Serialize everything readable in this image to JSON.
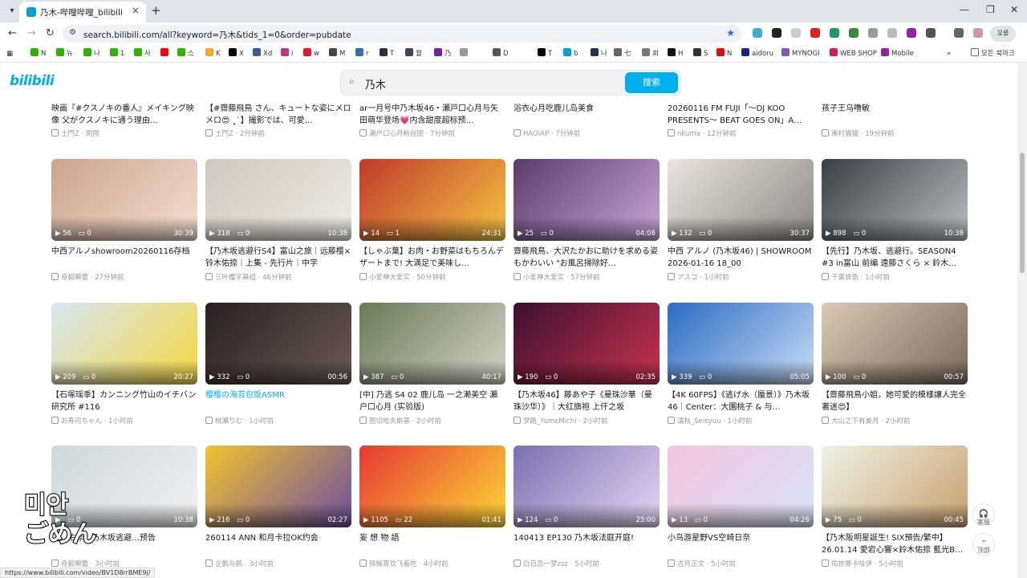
{
  "browser": {
    "tab_title": "乃木-哔哩哔哩_bilibili",
    "url": "search.bilibili.com/all?keyword=乃木&tids_1=0&order=pubdate",
    "profile_label": "오류",
    "bookmarks": [
      "N",
      "뉴",
      "나",
      "1",
      "사",
      "",
      "스",
      "K",
      "X",
      "Xd",
      "i",
      "w",
      "M",
      "r",
      "T",
      "월",
      "乃",
      "",
      "D",
      "T",
      "b",
      "나",
      "七",
      "회",
      "H",
      "S",
      "N",
      "aidoru",
      "MYNOGI",
      "WEB SHOP",
      "Mobile"
    ],
    "bookmark_folder": "모든 북마크",
    "status_url": "https://www.bilibili.com/video/BV1D8rrBME9j/"
  },
  "header": {
    "logo": "bilibili",
    "search_value": "乃木",
    "search_button": "搜索"
  },
  "top_row": [
    {
      "title": "映画『#クスノキの番人』メイキング映像 父がクスノキに通う理由…",
      "uploader": "土門Z",
      "time": "刚刚"
    },
    {
      "title": "【#齋藤飛鳥 さん、キュートな姿にメロメロ😍 ˎ̥ˋ】撮影では、可愛…",
      "uploader": "土門Z",
      "time": "2分钟前"
    },
    {
      "title": "ar一月号中乃木坂46・瀬戸口心月与矢田萌华登场💗内含甜度超标预…",
      "uploader": "濑户口心月粉丝团",
      "time": "7分钟前"
    },
    {
      "title": "浴衣心月吃鹿儿岛美食",
      "uploader": "HAOIAP",
      "time": "7分钟前"
    },
    {
      "title": "20260116 FM FUJI「～DJ KOO PRESENTS～ BEAT GOES ON」A…",
      "uploader": "nkuma",
      "time": "12分钟前"
    },
    {
      "title": "孩子王乌噜敏",
      "uploader": "東村猫猫",
      "time": "19分钟前"
    }
  ],
  "rows": [
    [
      {
        "views": "56",
        "danmaku": "0",
        "duration": "30:39",
        "title": "中西アルノshowroom20260116存档",
        "uploader": "奇毅瞬蕾",
        "time": "27分钟前",
        "hl": false
      },
      {
        "views": "318",
        "danmaku": "0",
        "duration": "10:38",
        "title": "【乃木坂逃避行S4】富山之旅｜远藤樱×铃木佑捺｜上集 - 先行片｜中字",
        "uploader": "三叶樱字幕组",
        "time": "46分钟前",
        "hl": false
      },
      {
        "views": "14",
        "danmaku": "1",
        "duration": "24:31",
        "title": "【しゃぶ葉】お肉・お野菜はもちろんデザートまで! 大満足で美味し…",
        "uploader": "小爱神大爱实",
        "time": "50分钟前",
        "hl": false
      },
      {
        "views": "25",
        "danmaku": "0",
        "duration": "04:08",
        "title": "齋藤飛鳥、大沢たかおに助けを求める姿もかわいい \"お風呂掃除好…",
        "uploader": "小爱神大爱实",
        "time": "57分钟前",
        "hl": false
      },
      {
        "views": "132",
        "danmaku": "0",
        "duration": "30:37",
        "title": "中西 アルノ (乃木坂46) | SHOWROOM 2026-01-16 18_00",
        "uploader": "アスコ",
        "time": "1小时前",
        "hl": false
      },
      {
        "views": "898",
        "danmaku": "0",
        "duration": "10:38",
        "title": "【先行】乃木坂、逃避行。SEASON4 #3 in富山 前编 遠藤さくら × 鈴木…",
        "uploader": "千葉鉄魚",
        "time": "1小时前",
        "hl": false
      }
    ],
    [
      {
        "views": "209",
        "danmaku": "0",
        "duration": "20:27",
        "title": "【石塚瑶季】カンニング竹山のイチバン研究所 #116",
        "uploader": "お寿司ちゃん",
        "time": "1小时前",
        "hl": false
      },
      {
        "views": "332",
        "danmaku": "0",
        "duration": "00:56",
        "title": "樱樱の海苔包饭ASMR",
        "uploader": "桃瀬りむ",
        "time": "1小时前",
        "hl": true
      },
      {
        "views": "387",
        "danmaku": "0",
        "duration": "40:17",
        "title": "[中] 乃逃 S4 02 鹿儿岛 一之濑美空 瀬户口心月 (实验版)",
        "uploader": "图切哈夫斯基",
        "time": "2小时前",
        "hl": false
      },
      {
        "views": "190",
        "danmaku": "0",
        "duration": "02:35",
        "title": "【乃木坂46】藤あや子《曼珠沙華（曼珠沙华）》｜大红旗袍 上仟之坂",
        "uploader": "梦路_YumeMichi",
        "time": "2小时前",
        "hl": false
      },
      {
        "views": "339",
        "danmaku": "0",
        "duration": "05:05",
        "title": "【4K 60FPS】《逃げ水（蜃景）》乃木坂46｜Center：大園桃子 & 与…",
        "uploader": "濡秋_Seisyuu",
        "time": "1小时前",
        "hl": false
      },
      {
        "views": "100",
        "danmaku": "0",
        "duration": "00:57",
        "title": "【齋藤飛鳥小姐，她可愛的模樣讓人完全著迷😍】",
        "uploader": "大山之下有美月",
        "time": "2小时前",
        "hl": false
      }
    ],
    [
      {
        "views": "",
        "danmaku": "0",
        "duration": "10:38",
        "title": "【…佑捺】乃木坂逃避…预告",
        "uploader": "奇毅瞬蕾",
        "time": "3小时前",
        "hl": false
      },
      {
        "views": "216",
        "danmaku": "0",
        "duration": "02:27",
        "title": "260114 ANN 和月卡拉OK约会",
        "uploader": "企鹅与鹤",
        "time": "3小时前",
        "hl": false
      },
      {
        "views": "1105",
        "danmaku": "22",
        "duration": "01:41",
        "title": "妄 想 物 語",
        "uploader": "猕猴喜欢飞着吃",
        "time": "4小时前",
        "hl": false
      },
      {
        "views": "124",
        "danmaku": "0",
        "duration": "25:00",
        "title": "140413 EP130 乃木坂法庭开庭!",
        "uploader": "白日忽一梦zzz",
        "time": "5小时前",
        "hl": false
      },
      {
        "views": "13",
        "danmaku": "0",
        "duration": "04:26",
        "title": "小鸟游星野VS空崎日奈",
        "uploader": "古月正文",
        "time": "5小时前",
        "hl": false
      },
      {
        "views": "75",
        "danmaku": "0",
        "duration": "00:45",
        "title": "【乃木阪明星誕生! SIX預告/繁中】26.01.14 愛宕心響×鈴木佑捺 藍光B…",
        "uploader": "佑捺寨卡哇伊",
        "time": "5小时前",
        "hl": false
      }
    ]
  ],
  "side": {
    "service_label": "客服",
    "top_label": "顶部"
  },
  "overlay_lines": [
    "미안",
    "ごめん"
  ],
  "colors": {
    "accent": "#00aeec",
    "meta": "#9499a0"
  }
}
